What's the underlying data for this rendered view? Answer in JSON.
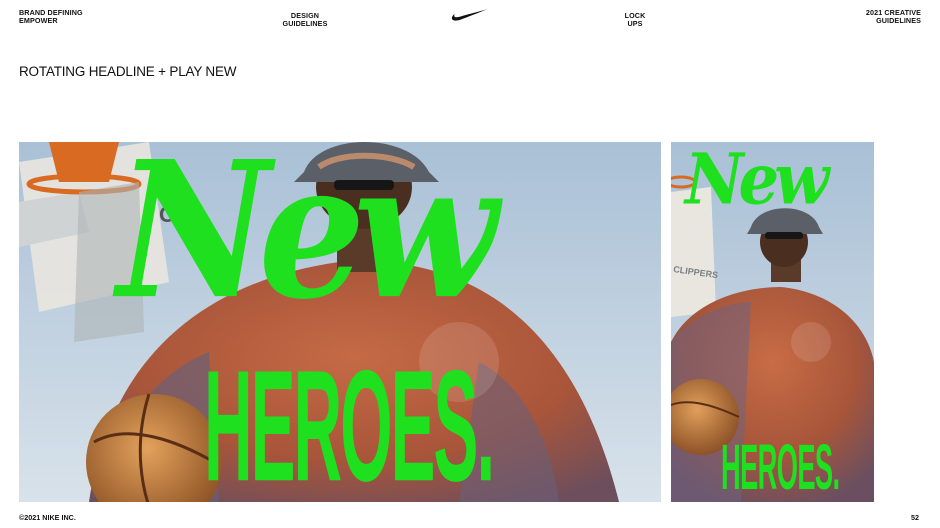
{
  "header": {
    "left_line1": "BRAND DEFINING",
    "left_line2": "EMPOWER",
    "design_line1": "DESIGN",
    "design_line2": "GUIDELINES",
    "lock_line1": "LOCK",
    "lock_line2": "UPS",
    "right_line1": "2021 CREATIVE",
    "right_line2": "GUIDELINES",
    "logo_icon": "nike-swoosh-icon"
  },
  "slide": {
    "title": "ROTATING HEADLINE + PLAY NEW"
  },
  "images": {
    "wide": {
      "headline_top": "New",
      "headline_bottom": "HEROES.",
      "backboard_text": "C"
    },
    "tall": {
      "headline_top": "New",
      "headline_bottom": "HEROES.",
      "backboard_text": "CLIPPERS"
    }
  },
  "colors": {
    "accent": "#1fe01f",
    "text": "#111111",
    "sky": "#b9cde0",
    "sweater": "#b9603e"
  },
  "footer": {
    "copyright": "©2021 NIKE INC.",
    "page_number": "52"
  }
}
